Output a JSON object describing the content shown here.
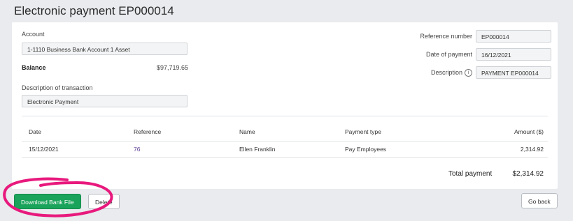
{
  "page": {
    "title": "Electronic payment EP000014"
  },
  "account": {
    "label": "Account",
    "value": "1-1110 Business Bank Account 1 Asset",
    "balance_label": "Balance",
    "balance_value": "$97,719.65"
  },
  "description_of_transaction": {
    "label": "Description of transaction",
    "value": "Electronic Payment"
  },
  "reference_number": {
    "label": "Reference number",
    "value": "EP000014"
  },
  "date_of_payment": {
    "label": "Date of payment",
    "value": "16/12/2021"
  },
  "description": {
    "label": "Description",
    "value": "PAYMENT EP000014",
    "icon": "info-icon"
  },
  "table": {
    "headers": [
      "Date",
      "Reference",
      "Name",
      "Payment type",
      "Amount ($)"
    ],
    "rows": [
      [
        "15/12/2021",
        "76",
        "Ellen Franklin",
        "Pay Employees",
        "2,314.92"
      ]
    ]
  },
  "total": {
    "label": "Total payment",
    "value": "$2,314.92"
  },
  "buttons": {
    "download": "Download Bank File",
    "delete": "Delete",
    "go_back": "Go back"
  },
  "colors": {
    "primary_button": "#1aa35a",
    "annotation": "#e8197d",
    "link": "#5a3b93"
  }
}
